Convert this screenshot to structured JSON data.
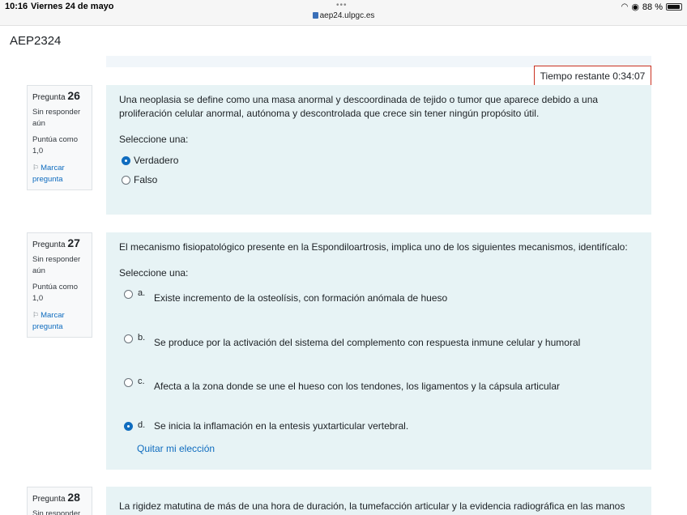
{
  "status_bar": {
    "time": "10:16",
    "date": "Viernes 24 de mayo",
    "url": "aep24.ulpgc.es",
    "battery": "88 %"
  },
  "app": {
    "title": "AEP2324"
  },
  "timer": {
    "label": "Tiempo restante 0:34:07"
  },
  "questions": [
    {
      "label": "Pregunta",
      "number": "26",
      "state": "Sin responder aún",
      "grade": "Puntúa como 1,0",
      "flag": "Marcar pregunta",
      "text": "Una neoplasia se define como una masa anormal y descoordinada de tejido o tumor que aparece debido a una proliferación celular anormal, autónoma y descontrolada que crece sin tener ningún propósito útil.",
      "prompt": "Seleccione una:",
      "options": [
        {
          "text": "Verdadero",
          "selected": true
        },
        {
          "text": "Falso",
          "selected": false
        }
      ]
    },
    {
      "label": "Pregunta",
      "number": "27",
      "state": "Sin responder aún",
      "grade": "Puntúa como 1,0",
      "flag": "Marcar pregunta",
      "text": "El mecanismo fisiopatológico presente en la Espondiloartrosis, implica uno de los siguientes mecanismos, identifícalo:",
      "prompt": "Seleccione una:",
      "options": [
        {
          "letter": "a.",
          "text": "Existe incremento de la osteolísis, con formación anómala de hueso",
          "selected": false
        },
        {
          "letter": "b.",
          "text": "Se produce por la activación del sistema del complemento con respuesta inmune celular y humoral",
          "selected": false
        },
        {
          "letter": "c.",
          "text": "Afecta a la zona donde se une el hueso con los tendones, los ligamentos y la cápsula articular",
          "selected": false
        },
        {
          "letter": "d.",
          "text": "Se inicia la inflamación en la entesis yuxtarticular vertebral.",
          "selected": true
        }
      ],
      "clear_choice": "Quitar mi elección"
    },
    {
      "label": "Pregunta",
      "number": "28",
      "state": "Sin responder",
      "text": "La rigidez matutina de más de una hora de duración, la tumefacción articular y la evidencia radiográfica en las manos"
    }
  ]
}
